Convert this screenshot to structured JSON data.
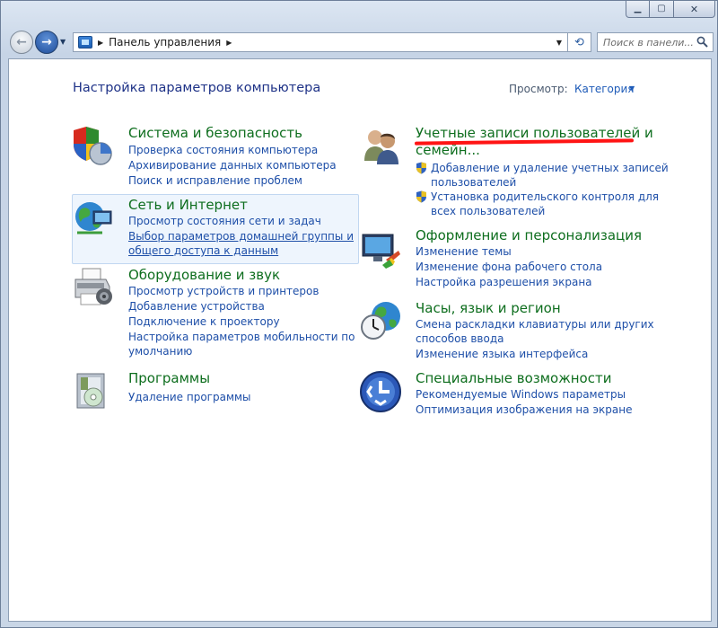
{
  "address_bar": {
    "path": "Панель управления"
  },
  "search": {
    "placeholder": "Поиск в панели..."
  },
  "header": {
    "title": "Настройка параметров компьютера",
    "view_by_label": "Просмотр:",
    "view_by_value": "Категория"
  },
  "left_categories": [
    {
      "title": "Система и безопасность",
      "icon": "shield-icon",
      "links": [
        "Проверка состояния компьютера",
        "Архивирование данных компьютера",
        "Поиск и исправление проблем"
      ]
    },
    {
      "title": "Сеть и Интернет",
      "icon": "network-globe-icon",
      "links": [
        "Просмотр состояния сети и задач",
        "Выбор параметров домашней группы и",
        "общего доступа к данным"
      ]
    },
    {
      "title": "Оборудование и звук",
      "icon": "printer-icon",
      "links": [
        "Просмотр устройств и принтеров",
        "Добавление устройства",
        "Подключение к проектору",
        "Настройка параметров мобильности по",
        "умолчанию"
      ]
    },
    {
      "title": "Программы",
      "icon": "programs-icon",
      "links": [
        "Удаление программы"
      ]
    }
  ],
  "right_categories": [
    {
      "title_line1": "Учетные записи пользователей и",
      "title_line2": "семейн...",
      "icon": "users-icon",
      "links": [
        "Добавление и удаление учетных записей",
        "пользователей",
        "Установка родительского контроля для",
        "всех пользователей"
      ]
    },
    {
      "title": "Оформление и персонализация",
      "icon": "appearance-icon",
      "links": [
        "Изменение темы",
        "Изменение фона рабочего стола",
        "Настройка разрешения экрана"
      ]
    },
    {
      "title": "Часы, язык и регион",
      "icon": "clock-globe-icon",
      "links": [
        "Смена раскладки клавиатуры или других",
        "способов ввода",
        "Изменение языка интерфейса"
      ]
    },
    {
      "title": "Специальные возможности",
      "icon": "accessibility-icon",
      "links": [
        "Рекомендуемые Windows параметры",
        "Оптимизация изображения на экране"
      ]
    }
  ],
  "colors": {
    "title_green": "#0e6e1e",
    "link_blue": "#1e4fa8",
    "annotation_red": "#ff1414"
  }
}
